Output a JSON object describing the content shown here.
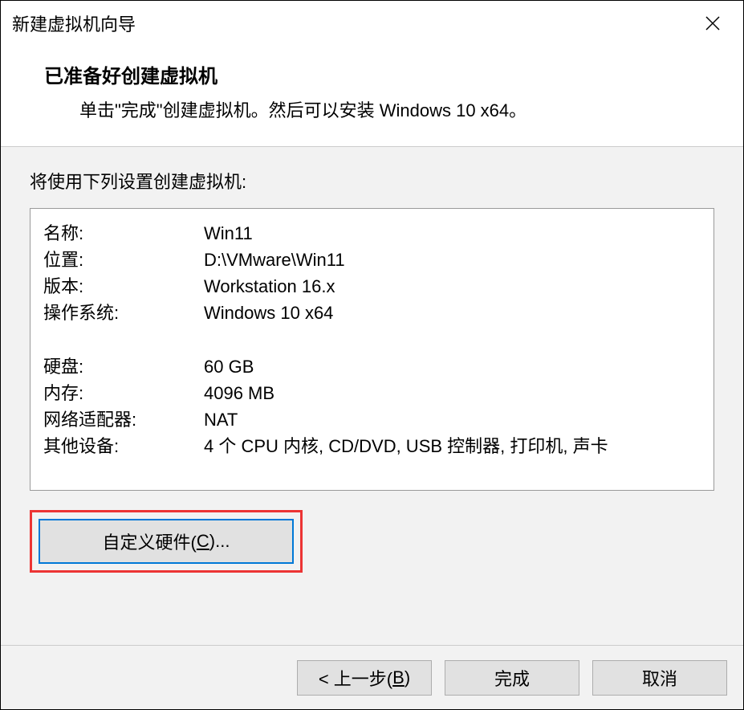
{
  "dialog": {
    "title": "新建虚拟机向导",
    "heading": "已准备好创建虚拟机",
    "subheading": "单击\"完成\"创建虚拟机。然后可以安装 Windows 10 x64。"
  },
  "settings": {
    "intro": "将使用下列设置创建虚拟机:",
    "group1": [
      {
        "label": "名称:",
        "value": "Win11"
      },
      {
        "label": "位置:",
        "value": "D:\\VMware\\Win11"
      },
      {
        "label": "版本:",
        "value": "Workstation 16.x"
      },
      {
        "label": "操作系统:",
        "value": "Windows 10 x64"
      }
    ],
    "group2": [
      {
        "label": "硬盘:",
        "value": "60 GB"
      },
      {
        "label": "内存:",
        "value": "4096 MB"
      },
      {
        "label": "网络适配器:",
        "value": "NAT"
      },
      {
        "label": "其他设备:",
        "value": "4 个 CPU 内核, CD/DVD, USB 控制器, 打印机, 声卡"
      }
    ]
  },
  "buttons": {
    "customize_pre": "自定义硬件(",
    "customize_key": "C",
    "customize_post": ")...",
    "back_pre": "< 上一步(",
    "back_key": "B",
    "back_post": ")",
    "finish": "完成",
    "cancel": "取消"
  }
}
